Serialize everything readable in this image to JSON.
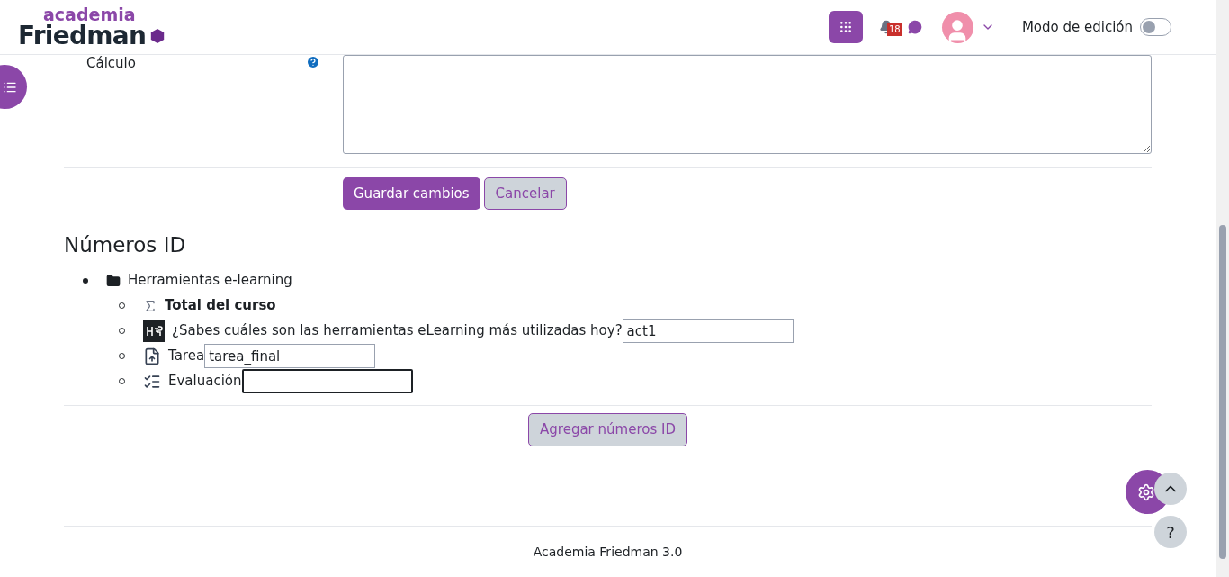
{
  "header": {
    "logo_top": "academia",
    "logo_bottom": "Friedman",
    "notification_count": "18",
    "edit_mode": {
      "label": "Modo de edición",
      "on": false
    }
  },
  "form": {
    "field_label": "Cálculo",
    "buttons": [
      {
        "label": "Guardar cambios",
        "kind": "primary"
      },
      {
        "label": "Cancelar",
        "kind": "secondary"
      }
    ]
  },
  "id_numbers": {
    "title": "Números ID",
    "tree": [
      {
        "kind": "folder",
        "label": "Herramientas e-learning",
        "children": [
          {
            "kind": "total",
            "label": "Total del curso"
          },
          {
            "kind": "h5p",
            "label": "¿Sabes cuáles son las herramientas eLearning más utilizadas hoy?",
            "value": "act1",
            "focused": false
          },
          {
            "kind": "assign",
            "label": "Tarea",
            "value": "tarea_final",
            "focused": false
          },
          {
            "kind": "quiz",
            "label": "Evaluación",
            "focused": true
          }
        ]
      }
    ],
    "button": "Agregar números ID"
  },
  "footer": "Academia Friedman 3.0",
  "help_button": "?"
}
